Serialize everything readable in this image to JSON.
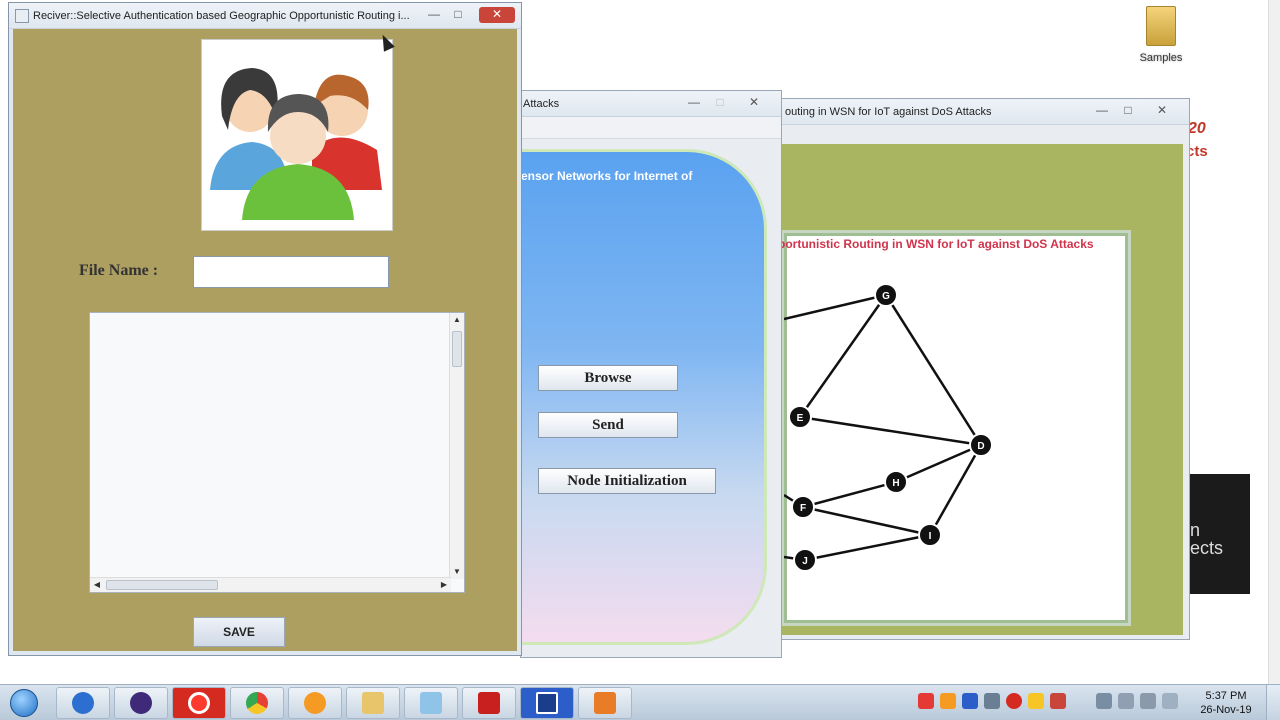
{
  "desktop": {
    "folder_label": "Samples",
    "bg_fragments": [
      "20",
      "cts",
      "n",
      "ects"
    ]
  },
  "win_receiver": {
    "title": "Reciver::Selective Authentication based Geographic Opportunistic Routing i...",
    "file_name_label": "File Name  :",
    "file_name_value": "",
    "save_label": "SAVE"
  },
  "win_sender": {
    "title": "Attacks",
    "heading_fragment": "ensor Networks for Internet of",
    "buttons": [
      "Browse",
      "Send",
      "Node Initialization"
    ]
  },
  "win_network": {
    "title": "outing in WSN for IoT against DoS Attacks",
    "panel_title": "portunistic Routing in WSN for IoT against DoS Attacks",
    "nodes": [
      "G",
      "E",
      "D",
      "H",
      "F",
      "I",
      "J"
    ]
  },
  "taskbar": {
    "apps": [
      "start-orb",
      "ie",
      "eclipse",
      "opera",
      "chrome",
      "firefox-like",
      "explorer",
      "notepad",
      "acrobat",
      "app-blue",
      "java"
    ],
    "time": "5:37 PM",
    "date": "26-Nov-19"
  },
  "colors": {
    "receiver_bg": "#ad9f5f",
    "network_bg": "#aab562",
    "graph_title": "#d0344c",
    "sender_panel_top": "#5aa2f0"
  }
}
